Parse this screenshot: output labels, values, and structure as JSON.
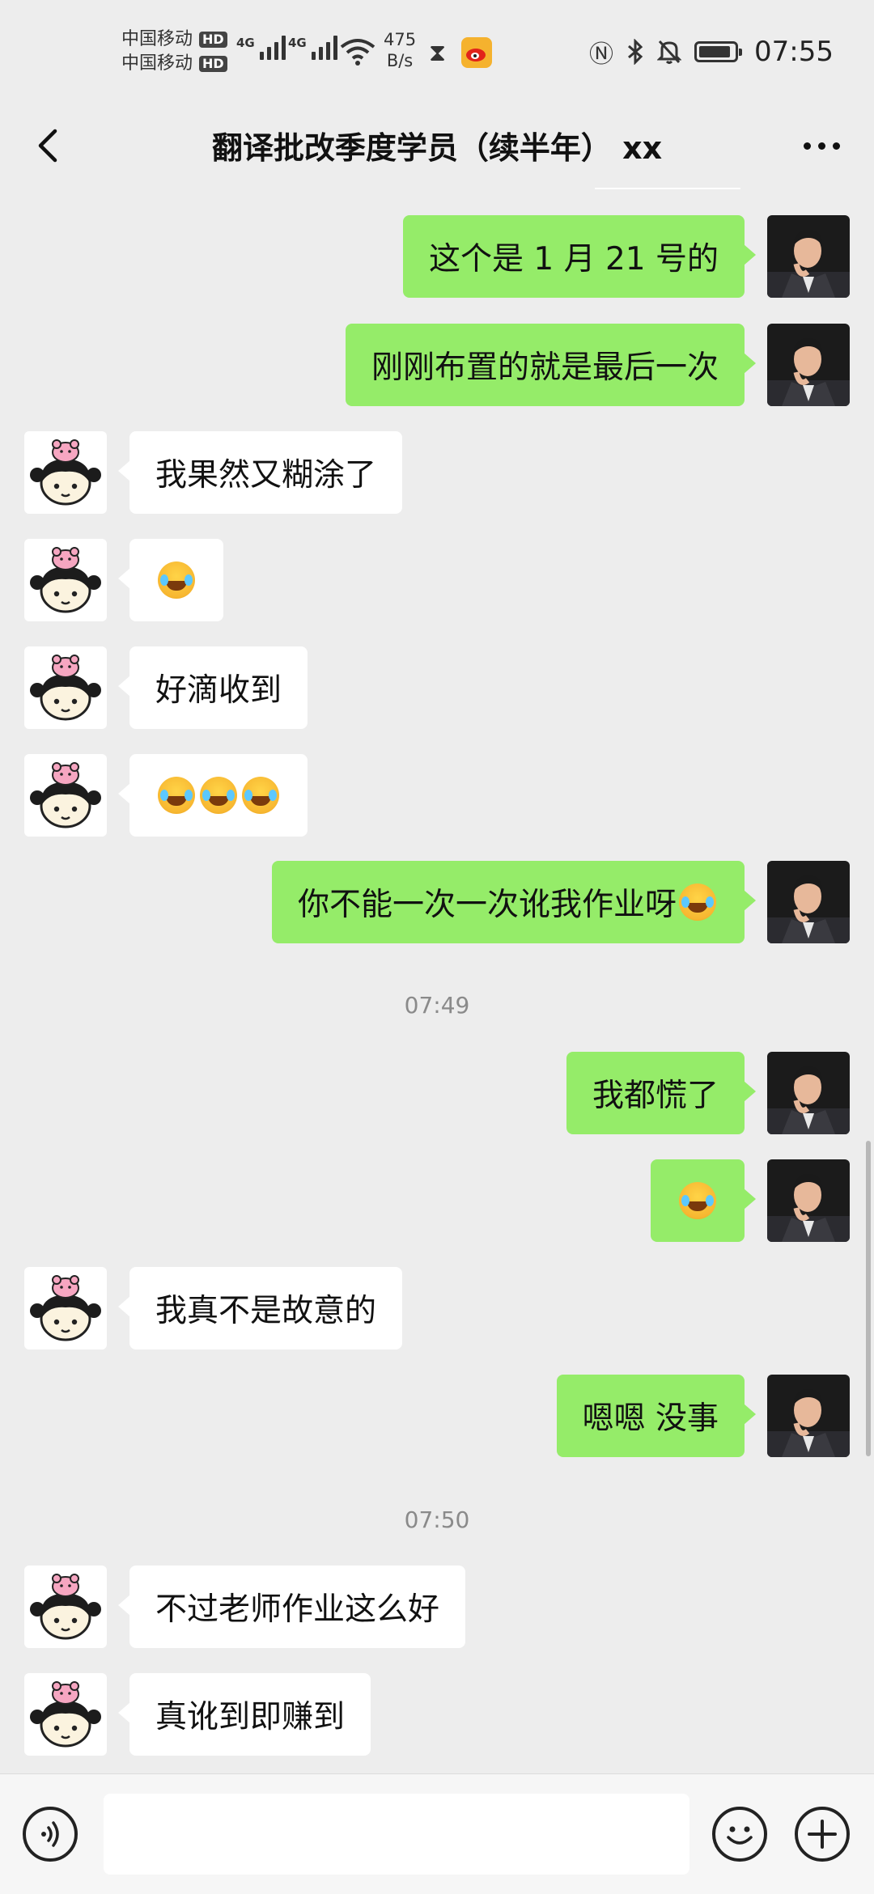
{
  "status_bar": {
    "carrier_1": "中国移动",
    "carrier_2": "中国移动",
    "hd_label": "HD",
    "network_1": "4G",
    "network_2": "4G",
    "net_speed_value": "475",
    "net_speed_unit": "B/s",
    "time": "07:55",
    "battery_level": 0.9,
    "icons": [
      "signal-icon",
      "wifi-icon",
      "hourglass-icon",
      "weibo-icon",
      "nfc-icon",
      "bluetooth-icon",
      "mute-icon",
      "battery-icon"
    ]
  },
  "nav": {
    "title": "翻译批改季度学员（续半年） xx",
    "back_icon": "chevron-left-icon",
    "more_icon": "more-dots-icon"
  },
  "messages": [
    {
      "side": "right",
      "text": "这个是 1 月 21 号的"
    },
    {
      "side": "right",
      "text": "刚刚布置的就是最后一次"
    },
    {
      "side": "left",
      "text": "我果然又糊涂了"
    },
    {
      "side": "left",
      "text": "",
      "emoji_count": 1
    },
    {
      "side": "left",
      "text": "好滴收到"
    },
    {
      "side": "left",
      "text": "",
      "emoji_count": 3
    },
    {
      "side": "right",
      "text": "你不能一次一次讹我作业呀",
      "emoji_count": 1
    },
    {
      "type": "time",
      "text": "07:49"
    },
    {
      "side": "right",
      "text": "我都慌了"
    },
    {
      "side": "right",
      "text": "",
      "emoji_count": 1
    },
    {
      "side": "left",
      "text": "我真不是故意的"
    },
    {
      "side": "right",
      "text": "嗯嗯 没事"
    },
    {
      "type": "time",
      "text": "07:50"
    },
    {
      "side": "left",
      "text": "不过老师作业这么好"
    },
    {
      "side": "left",
      "text": "真讹到即赚到"
    }
  ],
  "colors": {
    "background": "#ededed",
    "sent_bubble": "#95ec69",
    "received_bubble": "#ffffff",
    "timestamp_text": "#8a8a8a"
  },
  "input_bar": {
    "voice_icon": "voice-icon",
    "emoji_icon": "emoji-icon",
    "add_icon": "plus-icon",
    "message_value": ""
  }
}
